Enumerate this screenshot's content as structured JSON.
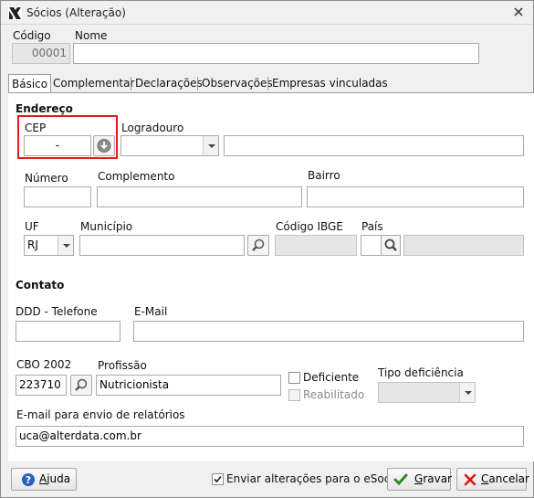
{
  "window": {
    "title": "Sócios (Alteração)"
  },
  "header": {
    "codigo_label": "Código",
    "codigo_value": "00001",
    "nome_label": "Nome",
    "nome_value": ""
  },
  "tabs": [
    {
      "label": "Básico",
      "active": true
    },
    {
      "label": "Complementar",
      "active": false
    },
    {
      "label": "Declarações",
      "active": false
    },
    {
      "label": "Observações",
      "active": false
    },
    {
      "label": "Empresas vinculadas",
      "active": false
    }
  ],
  "endereco": {
    "section_label": "Endereço",
    "cep_label": "CEP",
    "cep_value": "-",
    "logradouro_label": "Logradouro",
    "logradouro_type_value": "",
    "logradouro_value": "",
    "numero_label": "Número",
    "numero_value": "",
    "complemento_label": "Complemento",
    "complemento_value": "",
    "bairro_label": "Bairro",
    "bairro_value": "",
    "uf_label": "UF",
    "uf_value": "RJ",
    "municipio_label": "Município",
    "municipio_value": "",
    "ibge_label": "Código IBGE",
    "ibge_value": "",
    "pais_label": "País",
    "pais_code_value": "",
    "pais_value": ""
  },
  "contato": {
    "section_label": "Contato",
    "telefone_label": "DDD - Telefone",
    "telefone_value": "",
    "email_label": "E-Mail",
    "email_value": "",
    "cbo_label": "CBO 2002",
    "cbo_value": "223710",
    "profissao_label": "Profissão",
    "profissao_value": "Nutricionista",
    "deficiente_label": "Deficiente",
    "deficiente_checked": false,
    "reabilitado_label": "Reabilitado",
    "reabilitado_checked": false,
    "tipo_deficiencia_label": "Tipo deficiência",
    "tipo_deficiencia_value": "",
    "email_relatorios_label": "E-mail para envio de relatórios",
    "email_relatorios_value": "uca@alterdata.com.br"
  },
  "footer": {
    "ajuda_label": "Ajuda",
    "esocial_label": "Enviar alterações para o eSocial",
    "esocial_checked": true,
    "gravar_label": "Gravar",
    "cancelar_label": "Cancelar"
  },
  "colors": {
    "highlight_box": "#e41b1b",
    "ok_check": "#2e8b2e",
    "cancel_x": "#d21c1c",
    "help_blue": "#2a5fc1"
  }
}
